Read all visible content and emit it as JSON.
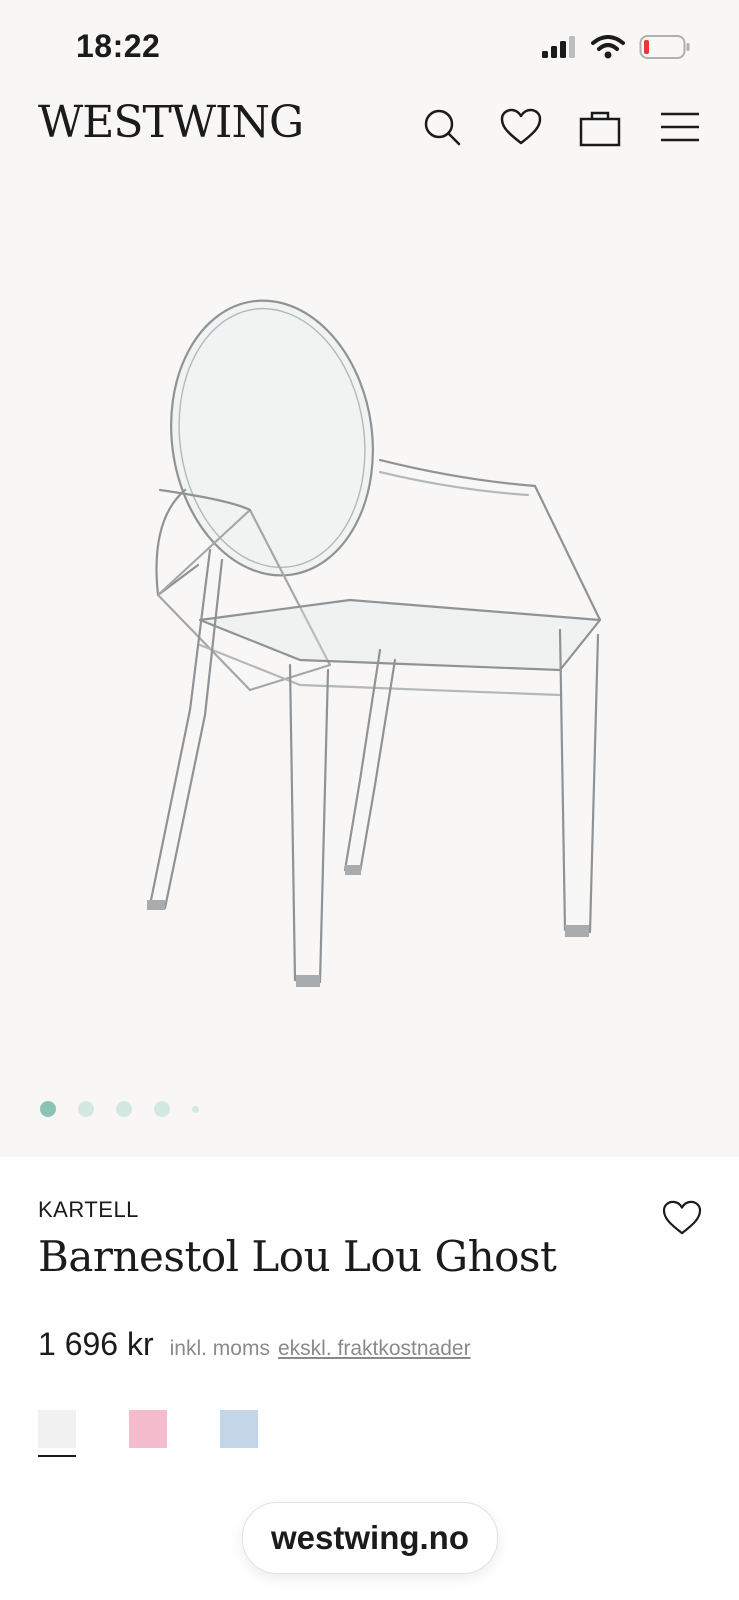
{
  "status_bar": {
    "time": "18:22"
  },
  "header": {
    "logo": "WESTWING",
    "icons": [
      "search-icon",
      "heart-icon",
      "bag-icon",
      "menu-icon"
    ]
  },
  "gallery": {
    "slide_count": 5,
    "active_index": 0
  },
  "product": {
    "brand": "KARTELL",
    "title": "Barnestol Lou Lou Ghost",
    "price": "1 696 kr",
    "vat_note": "inkl. moms",
    "shipping_link": "ekskl. fraktkostnader",
    "colors": [
      {
        "name": "clear",
        "hex": "#f1f1f1",
        "selected": true
      },
      {
        "name": "pink",
        "hex": "#f4bccc",
        "selected": false
      },
      {
        "name": "blue",
        "hex": "#c3d6e8",
        "selected": false
      }
    ]
  },
  "browser": {
    "url": "westwing.no"
  },
  "colors": {
    "background": "#f8f7f6",
    "accent_dot": "#8bc4b6",
    "text": "#1b1b1b"
  }
}
